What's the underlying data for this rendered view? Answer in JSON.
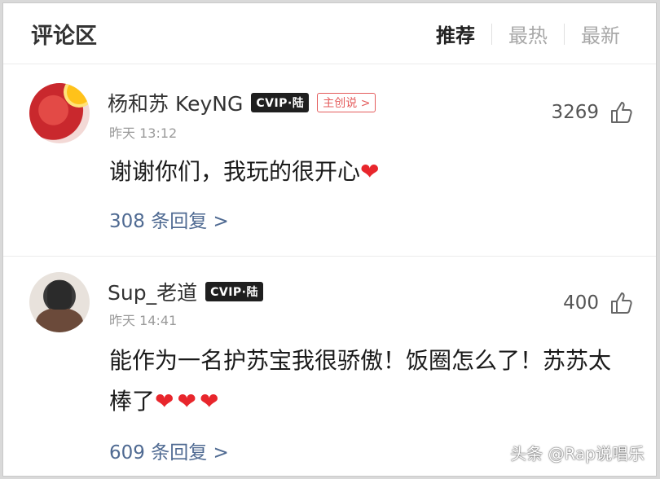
{
  "header": {
    "title": "评论区",
    "tabs": [
      {
        "label": "推荐",
        "active": true
      },
      {
        "label": "最热",
        "active": false
      },
      {
        "label": "最新",
        "active": false
      }
    ]
  },
  "comments": [
    {
      "user": "杨和苏 KeyNG",
      "vip_badge": "CVIP·陆",
      "owner_badge": "主创说 >",
      "time": "昨天 13:12",
      "likes": "3269",
      "text": "谢谢你们，我玩的很开心",
      "hearts": "❤",
      "replies": "308 条回复 >"
    },
    {
      "user": "Sup_老道",
      "vip_badge": "CVIP·陆",
      "time": "昨天 14:41",
      "likes": "400",
      "text": "能作为一名护苏宝我很骄傲！饭圈怎么了！苏苏太棒了",
      "hearts": "❤❤❤",
      "replies": "609 条回复 >"
    }
  ],
  "watermark": "头条 @Rap说唱乐",
  "colors": {
    "heart": "#e8262c",
    "reply_link": "#4f6a92",
    "owner_badge": "#e45c5c"
  }
}
